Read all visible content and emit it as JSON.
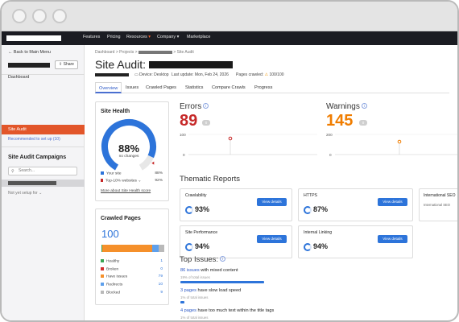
{
  "topnav": {
    "items": [
      "Features",
      "Pricing",
      "Resources",
      "Company",
      "Marketplace"
    ],
    "dropdown_marker": "▾"
  },
  "sidebar": {
    "back": "Back to Main Menu",
    "share": "Share",
    "dashboard": "Dashboard",
    "active": "Site Audit",
    "recommended": "Recommended to set up (10)",
    "campaigns_title": "Site Audit Campaigns",
    "search_placeholder": "Search...",
    "not_set_up": "Not yet setup for"
  },
  "breadcrumb": {
    "dashboard": "Dashboard",
    "projects": "Projects",
    "current": "Site Audit",
    "sep": ">"
  },
  "page": {
    "title": "Site Audit:",
    "device": "Device: Desktop",
    "last_update": "Last update: Mon, Feb 24, 2026",
    "pages_crawled_label": "Pages crawled:",
    "pages_crawled": "100/100"
  },
  "tabs": [
    "Overview",
    "Issues",
    "Crawled Pages",
    "Statistics",
    "Compare Crawls",
    "Progress"
  ],
  "site_health": {
    "title": "Site Health",
    "percent": "88%",
    "value": 88,
    "change": "no changes",
    "legend": [
      {
        "label": "Your site",
        "value": "88%",
        "color": "#2d74da"
      },
      {
        "label": "Top-10% websites",
        "value": "92%",
        "color": "#c62828"
      }
    ],
    "more": "More about Site Health score"
  },
  "errors": {
    "label": "Errors",
    "value": "89",
    "delta": "0",
    "axis_top": "100",
    "axis_bottom": "0",
    "color": "#c62828"
  },
  "warnings": {
    "label": "Warnings",
    "value": "145",
    "delta": "0",
    "axis_top": "200",
    "axis_bottom": "0",
    "color": "#f07d00"
  },
  "crawled_pages": {
    "title": "Crawled Pages",
    "total": "100",
    "rows": [
      {
        "label": "Healthy",
        "value": "1",
        "color": "#3aa655",
        "share": 1
      },
      {
        "label": "Broken",
        "value": "0",
        "color": "#d32f2f",
        "share": 0
      },
      {
        "label": "Have issues",
        "value": "79",
        "color": "#f5902b",
        "share": 79
      },
      {
        "label": "Redirects",
        "value": "10",
        "color": "#5ea0ec",
        "share": 10
      },
      {
        "label": "Blocked",
        "value": "9",
        "color": "#b9b9b9",
        "share": 9
      }
    ]
  },
  "thematic": {
    "title": "Thematic Reports",
    "button": "View details",
    "cards": [
      {
        "name": "Crawlability",
        "percent": "93%"
      },
      {
        "name": "HTTPS",
        "percent": "87%"
      },
      {
        "name": "Site Performance",
        "percent": "94%"
      },
      {
        "name": "Internal Linking",
        "percent": "94%"
      }
    ],
    "cut_card": {
      "name": "International SEO",
      "sub": "International SEO"
    }
  },
  "top_issues": {
    "title": "Top Issues:",
    "items": [
      {
        "link": "86 issues",
        "text": " with mixed content",
        "sub": "19% of total issues",
        "share": 0.19
      },
      {
        "link": "3 pages",
        "text": " have slow load speed",
        "sub": "1% of total issues",
        "share": 0.01
      },
      {
        "link": "4 pages",
        "text": " have too much text within the title tags",
        "sub": "1% of total issues",
        "share": 0.01
      }
    ]
  },
  "colors": {
    "accent": "#2d74da",
    "sidebar_active": "#e2562a",
    "topnav": "#1b1c22"
  }
}
